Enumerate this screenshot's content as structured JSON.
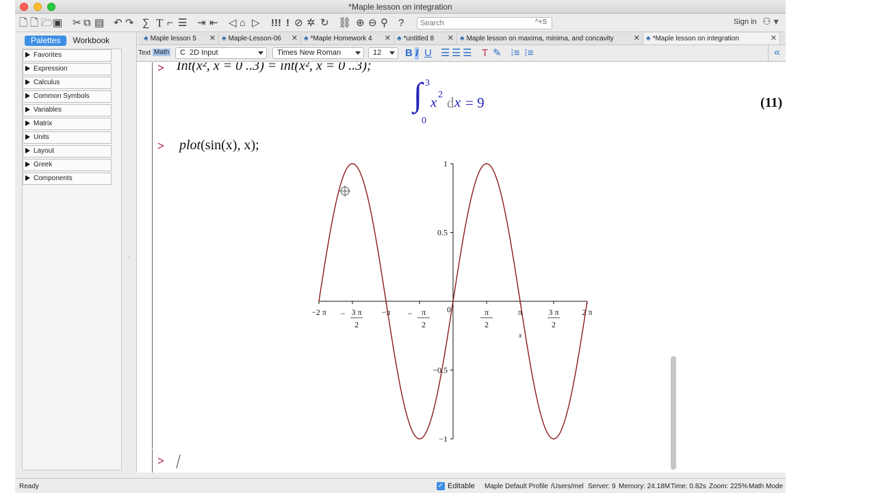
{
  "window": {
    "title": "*Maple lesson on integration"
  },
  "toolbar": {
    "search_placeholder": "Search",
    "search_shortcut": "^+S",
    "signin_label": "Sign in"
  },
  "left_panel": {
    "tabs": [
      "Palettes",
      "Workbook"
    ],
    "palettes": [
      "Favorites",
      "Expression",
      "Calculus",
      "Common Symbols",
      "Variables",
      "Matrix",
      "Units",
      "Layout",
      "Greek",
      "Components"
    ]
  },
  "doc_tabs": [
    {
      "label": "Maple lesson 5",
      "active": false
    },
    {
      "label": "Maple-Lesson-06",
      "active": false
    },
    {
      "label": "*Maple Homework 4",
      "active": false
    },
    {
      "label": "*untitled 8",
      "active": false
    },
    {
      "label": "Maple lesson on maxima, minima, and concavity",
      "active": false
    },
    {
      "label": "*Maple lesson on integration",
      "active": true
    }
  ],
  "formatbar": {
    "text_label": "Text",
    "math_label": "Math",
    "input_mode": "2D Input",
    "font": "Times New Roman",
    "size": "12"
  },
  "document": {
    "line1": {
      "prompt": ">",
      "input": "Int(x², x = 0 ..3) = int(x², x = 0 ..3);"
    },
    "output1": {
      "upper": "3",
      "lower": "0",
      "body": "x",
      "exponent": "2",
      "dx": "d",
      "dvar": "x",
      "equals": "= 9",
      "label": "(11)"
    },
    "line2": {
      "prompt": ">",
      "input_fn": "plot",
      "input_args": "(sin(x), x);"
    },
    "line3": {
      "prompt": ">"
    }
  },
  "chart_data": {
    "type": "line",
    "function": "sin(x)",
    "xlim": [
      -6.2832,
      6.2832
    ],
    "ylim": [
      -1,
      1
    ],
    "series": [
      {
        "color": "#8b1a1a",
        "x": [
          -6.2832,
          -5.4978,
          -4.7124,
          -3.927,
          -3.1416,
          -2.3562,
          -1.5708,
          -0.7854,
          0,
          0.7854,
          1.5708,
          2.3562,
          3.1416,
          3.927,
          4.7124,
          5.4978,
          6.2832
        ],
        "y": [
          0,
          0.7071,
          1,
          0.7071,
          0,
          -0.7071,
          -1,
          -0.7071,
          0,
          0.7071,
          1,
          0.7071,
          0,
          -0.7071,
          -1,
          -0.7071,
          0
        ]
      }
    ],
    "x_ticks": [
      {
        "value": -6.2832,
        "label": "−2 π"
      },
      {
        "value": -4.7124,
        "label": "− 3 π / 2"
      },
      {
        "value": -3.1416,
        "label": "−π"
      },
      {
        "value": -1.5708,
        "label": "− π / 2"
      },
      {
        "value": 0,
        "label": "0"
      },
      {
        "value": 1.5708,
        "label": "π / 2"
      },
      {
        "value": 3.1416,
        "label": "π"
      },
      {
        "value": 4.7124,
        "label": "3 π / 2"
      },
      {
        "value": 6.2832,
        "label": "2 π"
      }
    ],
    "y_ticks": [
      {
        "value": 1,
        "label": "1"
      },
      {
        "value": 0.5,
        "label": "0.5"
      },
      {
        "value": -0.5,
        "label": "−0.5"
      },
      {
        "value": -1,
        "label": "−1"
      }
    ],
    "xlabel": "x"
  },
  "status": {
    "left": "Ready",
    "editable": "Editable",
    "profile": "Maple Default Profile",
    "path": "/Users/mel",
    "server": "Server: 9",
    "memory": "Memory: 24.18M",
    "time": "Time: 0.82s",
    "zoom": "Zoom: 225%",
    "mode": "Math Mode"
  },
  "colors": {
    "accent": "#3d8ee5",
    "prompt": "#a0102a",
    "plot_line": "#8b1a1a",
    "output": "#2323b8"
  }
}
